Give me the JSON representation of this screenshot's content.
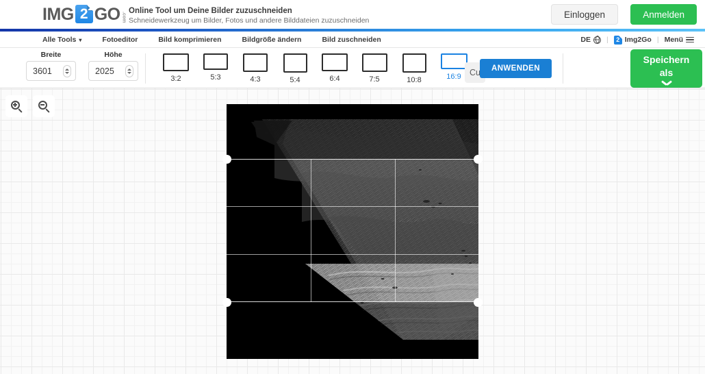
{
  "header": {
    "logo": {
      "part1": "IMG",
      "part2": "2",
      "part3": "GO",
      "tld": ".com"
    },
    "title": "Online Tool um Deine Bilder zuzuschneiden",
    "subtitle": "Schneidewerkzeug um Bilder, Fotos und andere Bilddateien zuzuschneiden",
    "login_label": "Einloggen",
    "signup_label": "Anmelden"
  },
  "nav": {
    "items": [
      {
        "label": "Alle Tools",
        "has_chevron": true
      },
      {
        "label": "Fotoeditor",
        "has_chevron": false
      },
      {
        "label": "Bild komprimieren",
        "has_chevron": false
      },
      {
        "label": "Bildgröße ändern",
        "has_chevron": false
      },
      {
        "label": "Bild zuschneiden",
        "has_chevron": false
      }
    ],
    "language": "DE",
    "separator": "|",
    "brand": "Img2Go",
    "brand_badge": "2",
    "menu_label": "Menü"
  },
  "toolbar": {
    "width_label": "Breite",
    "width_value": "3601",
    "height_label": "Höhe",
    "height_value": "2025",
    "ratios": [
      {
        "label": "3:2",
        "active": false
      },
      {
        "label": "5:3",
        "active": false
      },
      {
        "label": "4:3",
        "active": false
      },
      {
        "label": "5:4",
        "active": false
      },
      {
        "label": "6:4",
        "active": false
      },
      {
        "label": "7:5",
        "active": false
      },
      {
        "label": "10:8",
        "active": false
      },
      {
        "label": "16:9",
        "active": true
      }
    ],
    "custom_label": "Cu",
    "apply_label": "ANWENDEN",
    "save_label_line1": "Speichern",
    "save_label_line2": "als"
  },
  "canvas": {
    "zoom_in_icon": "zoom-in-icon",
    "zoom_out_icon": "zoom-out-icon",
    "image_alt": "Graustufen-Geländebild mit diagonaler Gebirgskette",
    "crop_grid_lines": 4,
    "handles": 4
  },
  "colors": {
    "accent_blue": "#1a82e2",
    "apply_blue": "#1a7fd4",
    "green": "#2cbf52",
    "grid_line": "#e9e9e9",
    "text_dark": "#3a3a3a"
  }
}
